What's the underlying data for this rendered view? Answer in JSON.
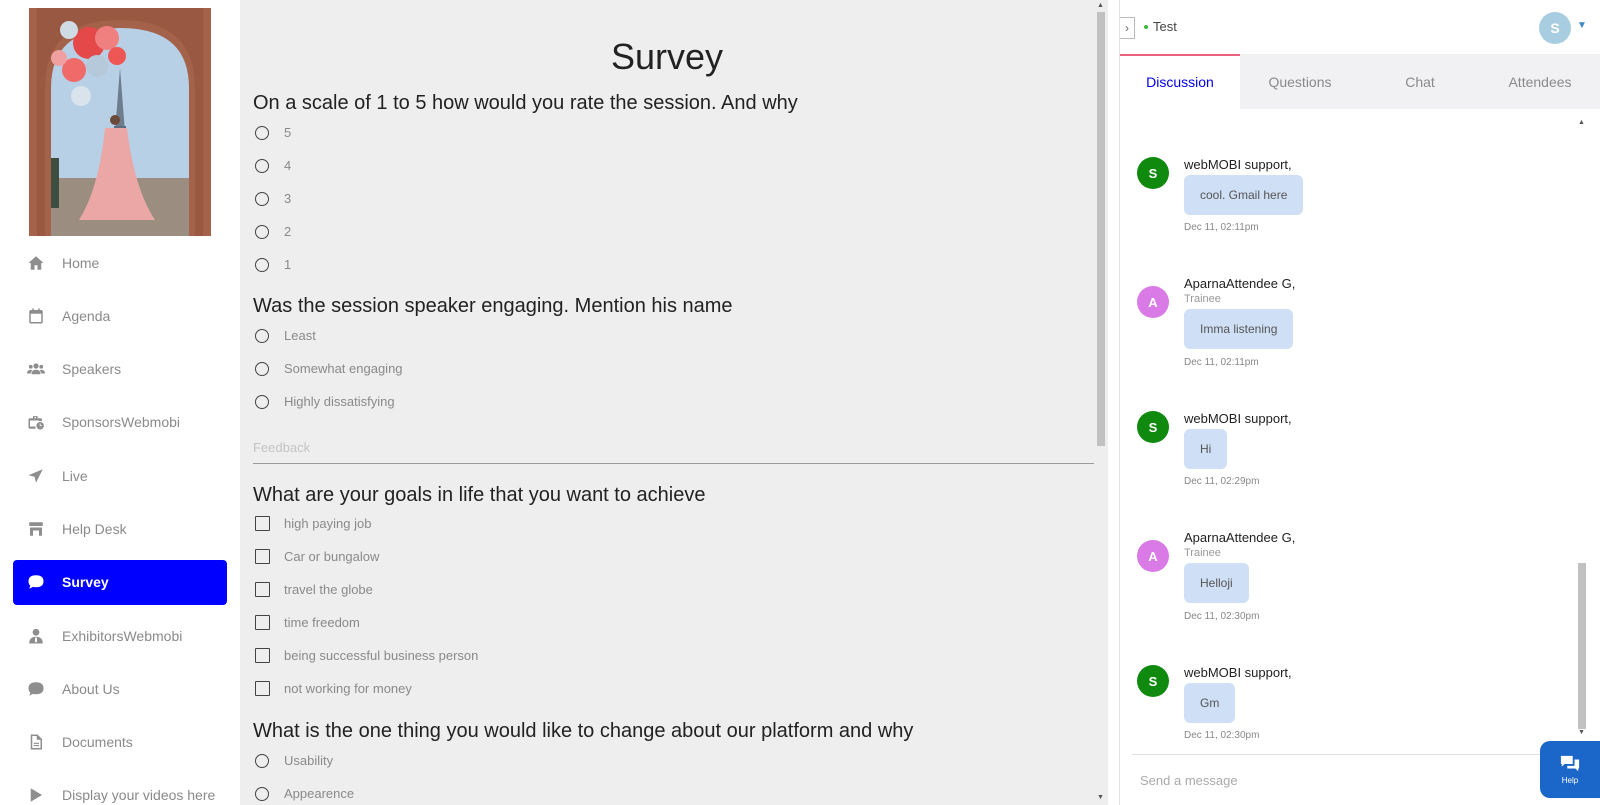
{
  "sidebar": {
    "banner_alt": "",
    "items": [
      {
        "label": "Home",
        "icon": "home-icon"
      },
      {
        "label": "Agenda",
        "icon": "calendar-icon"
      },
      {
        "label": "Speakers",
        "icon": "users-icon"
      },
      {
        "label": "SponsorsWebmobi",
        "icon": "briefcase-clock-icon"
      },
      {
        "label": "Live",
        "icon": "paper-plane-icon"
      },
      {
        "label": "Help Desk",
        "icon": "store-icon"
      },
      {
        "label": "Survey",
        "icon": "comment-icon",
        "active": true
      },
      {
        "label": "ExhibitorsWebmobi",
        "icon": "user-tie-icon"
      },
      {
        "label": "About Us",
        "icon": "comment-icon"
      },
      {
        "label": "Documents",
        "icon": "document-icon"
      },
      {
        "label": "Display your videos here",
        "icon": "play-icon"
      }
    ]
  },
  "survey": {
    "title": "Survey",
    "q1": {
      "text": "On a scale of 1 to 5 how would you rate the session. And why",
      "options": [
        "5",
        "4",
        "3",
        "2",
        "1"
      ]
    },
    "q2": {
      "text": "Was the session speaker engaging. Mention his name",
      "options": [
        "Least",
        "Somewhat engaging",
        "Highly dissatisfying"
      ]
    },
    "feedback_placeholder": "Feedback",
    "q3": {
      "text": "What are your goals in life that you want to achieve",
      "options": [
        "high paying job",
        "Car or bungalow",
        "travel the globe",
        "time freedom",
        "being successful business person",
        "not working for money"
      ]
    },
    "q4": {
      "text": "What is the one thing you would like to change about our platform and why",
      "options": [
        "Usability",
        "Appearence"
      ]
    }
  },
  "panel": {
    "event_name": "Test",
    "user_initial": "S",
    "tabs": [
      "Discussion",
      "Questions",
      "Chat",
      "Attendees"
    ],
    "active_tab": "Discussion",
    "messages": [
      {
        "initial": "S",
        "color": "#0f8a0f",
        "name": "webMOBI support,",
        "role": "",
        "text": "cool. Gmail here",
        "time": "Dec 11, 02:11pm"
      },
      {
        "initial": "A",
        "color": "#d97ae6",
        "name": "AparnaAttendee G,",
        "role": "Trainee",
        "text": "Imma listening",
        "time": "Dec 11, 02:11pm"
      },
      {
        "initial": "S",
        "color": "#0f8a0f",
        "name": "webMOBI support,",
        "role": "",
        "text": "Hi",
        "time": "Dec 11, 02:29pm"
      },
      {
        "initial": "A",
        "color": "#d97ae6",
        "name": "AparnaAttendee G,",
        "role": "Trainee",
        "text": "Helloji",
        "time": "Dec 11, 02:30pm"
      },
      {
        "initial": "S",
        "color": "#0f8a0f",
        "name": "webMOBI support,",
        "role": "",
        "text": "Gm",
        "time": "Dec 11, 02:30pm"
      }
    ],
    "message_placeholder": "Send a message",
    "help_label": "Help"
  }
}
